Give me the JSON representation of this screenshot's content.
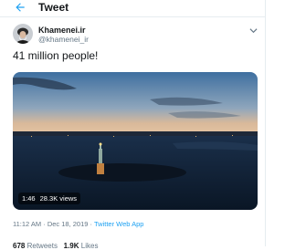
{
  "header": {
    "title": "Tweet",
    "back_icon": "back-arrow-icon"
  },
  "tweet": {
    "display_name": "Khamenei.ir",
    "handle": "@khamenei_ir",
    "text": "41 million people!",
    "video": {
      "duration": "1:46",
      "views": "28.3K views"
    },
    "time": "11:12 AM",
    "date": "Dec 18, 2019",
    "separator": "·",
    "source": "Twitter Web App",
    "retweets_count": "678",
    "retweets_label": "Retweets",
    "likes_count": "1.9K",
    "likes_label": "Likes"
  },
  "colors": {
    "accent": "#1da1f2",
    "secondary_text": "#657786",
    "primary_text": "#14171a"
  }
}
